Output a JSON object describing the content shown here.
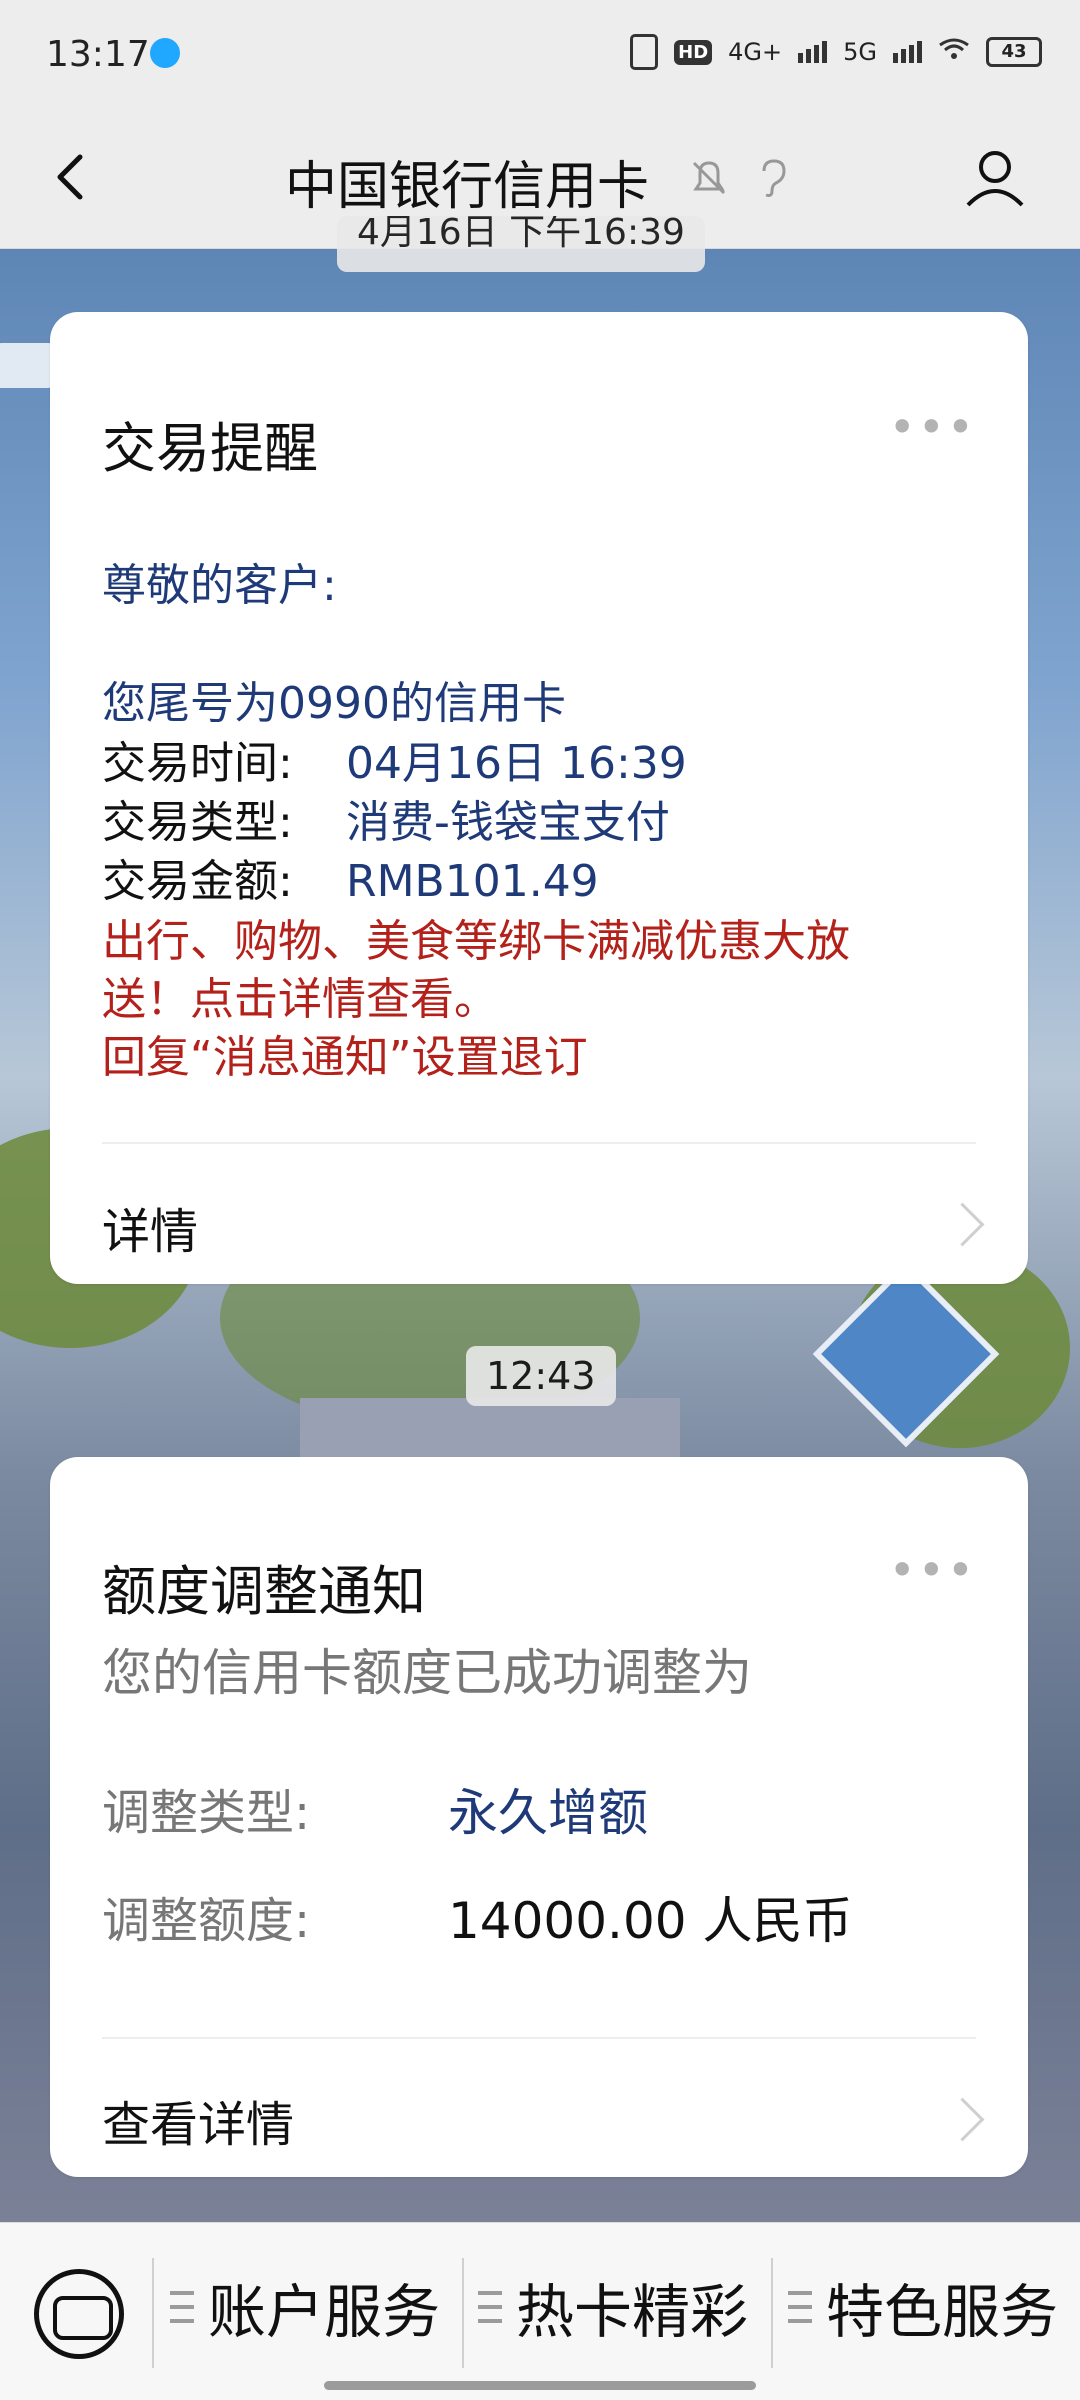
{
  "status": {
    "time": "13:17",
    "network1": "4G+",
    "network2": "5G",
    "battery": "43"
  },
  "navbar": {
    "title": "中国银行信用卡"
  },
  "timestamps": {
    "partial_top": "4月16日 下午16:39",
    "mid": "12:43"
  },
  "card1": {
    "title": "交易提醒",
    "greeting": "尊敬的客户:",
    "line1": "您尾号为0990的信用卡",
    "time_label": "交易时间:",
    "time_value": "04月16日  16:39",
    "type_label": "交易类型:",
    "type_value": "消费-钱袋宝支付",
    "amount_label": "交易金额:",
    "amount_value": "RMB101.49",
    "promo1": "出行、购物、美食等绑卡满减优惠大放",
    "promo2": "送！点击详情查看。",
    "promo3": "回复“消息通知”设置退订",
    "footer": "详情"
  },
  "card2": {
    "title": "额度调整通知",
    "subtitle": "您的信用卡额度已成功调整为",
    "adj_type_label": "调整类型:",
    "adj_type_value": "永久增额",
    "adj_amount_label": "调整额度:",
    "adj_amount_value": "14000.00  人民币",
    "footer": "查看详情"
  },
  "bottom_menu": {
    "items": [
      "账户服务",
      "热卡精彩",
      "特色服务"
    ]
  }
}
